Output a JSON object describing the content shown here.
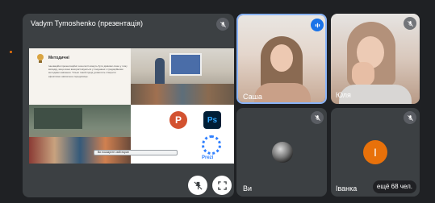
{
  "presenter": {
    "name": "Vadym Tymoshenko (презентація)"
  },
  "slide": {
    "heading": "Методичні",
    "body": "Інноваційні презентаційні технології можуть бути дієвими лише у тому випадку, якщо вони використовуються у поєднанні з традиційними методами навчання. Тільки такий підхід дозволить створити ефективне навчальне середовище.",
    "brand_powerpoint": "P",
    "brand_photoshop": "Ps",
    "brand_prezi": "Prezi",
    "share_banner": "Ви показуєте свій екран"
  },
  "participants": [
    {
      "name": "Саша",
      "speaking": true
    },
    {
      "name": "Юля",
      "speaking": false
    },
    {
      "name": "Ви",
      "speaking": false
    },
    {
      "name": "Іванка",
      "initial": "І",
      "speaking": false
    }
  ],
  "more_people": "ещё 68 чел.",
  "colors": {
    "background": "#1f2124",
    "tile": "#3c4043",
    "speaking_border": "#8ab4f8",
    "avatar_orange": "#e8710a"
  }
}
